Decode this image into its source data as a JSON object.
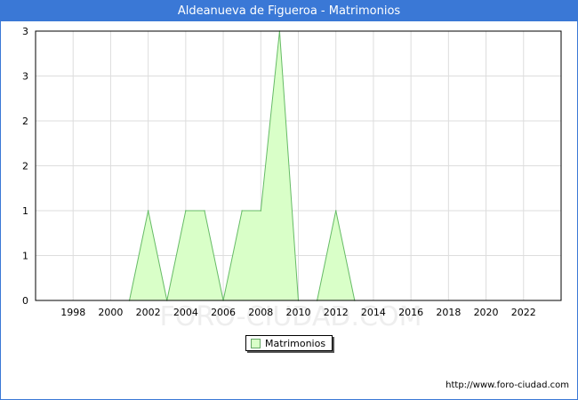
{
  "header": {
    "title": "Aldeanueva de Figueroa - Matrimonios"
  },
  "watermark": "FORO-CIUDAD.COM",
  "source": "http://www.foro-ciudad.com",
  "colors": {
    "title_bar": "#3a78d6",
    "area_fill": "#d9ffc8",
    "area_line": "#66bb66",
    "grid": "#dddddd"
  },
  "chart_data": {
    "type": "area",
    "title": "Aldeanueva de Figueroa - Matrimonios",
    "xlabel": "",
    "ylabel": "",
    "x_ticks": [
      "1998",
      "2000",
      "2002",
      "2004",
      "2006",
      "2008",
      "2010",
      "2012",
      "2014",
      "2016",
      "2018",
      "2020",
      "2022"
    ],
    "y_ticks": [
      "0",
      "1",
      "1",
      "2",
      "2",
      "3",
      "3"
    ],
    "xlim": [
      1996,
      2024
    ],
    "ylim": [
      0,
      3
    ],
    "grid": true,
    "legend": "bottom-center",
    "series": [
      {
        "name": "Matrimonios",
        "x": [
          2001,
          2002,
          2003,
          2004,
          2005,
          2006,
          2007,
          2008,
          2009,
          2010,
          2011,
          2012,
          2013
        ],
        "y": [
          0,
          1,
          0,
          1,
          1,
          0,
          1,
          1,
          3,
          0,
          0,
          1,
          0
        ]
      }
    ]
  }
}
